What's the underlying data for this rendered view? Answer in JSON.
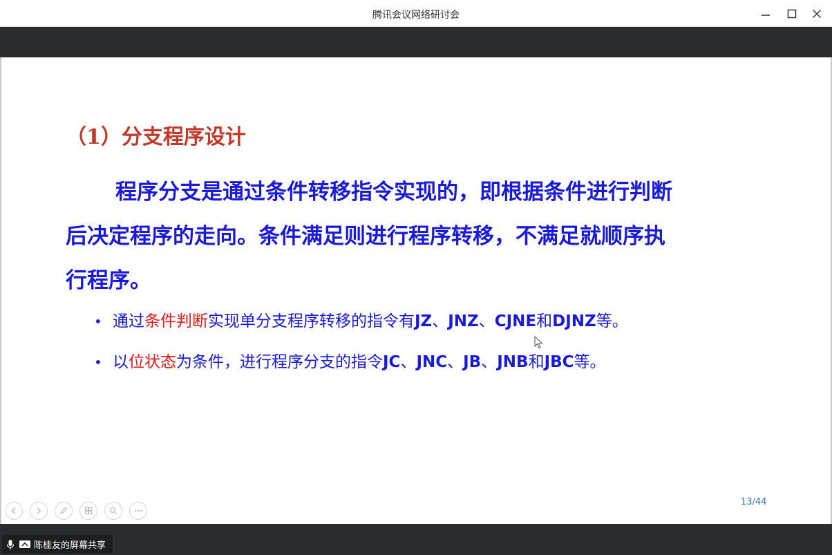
{
  "window": {
    "title": "腾讯会议网络研讨会",
    "controls": [
      "minimize-icon",
      "maximize-icon",
      "close-icon"
    ]
  },
  "slide": {
    "heading": "（1）分支程序设计",
    "paragraph_lines": [
      "程序分支是通过条件转移指令实现的，即根据条件进行判断",
      "后决定程序的走向。条件满足则进行程序转移，不满足就顺序执",
      "行程序。"
    ],
    "bullets": [
      {
        "marker": "•",
        "parts": [
          {
            "text": "通过",
            "style": "normal"
          },
          {
            "text": "条件判断",
            "style": "highlight"
          },
          {
            "text": "实现单分支程序转移的指令有",
            "style": "normal"
          },
          {
            "text": "JZ",
            "style": "code"
          },
          {
            "text": "、",
            "style": "normal"
          },
          {
            "text": "JNZ",
            "style": "code"
          },
          {
            "text": "、",
            "style": "normal"
          },
          {
            "text": "CJNE",
            "style": "code"
          },
          {
            "text": "和",
            "style": "normal"
          },
          {
            "text": "DJNZ",
            "style": "code"
          },
          {
            "text": "等。",
            "style": "normal"
          }
        ]
      },
      {
        "marker": "•",
        "parts": [
          {
            "text": "以",
            "style": "normal"
          },
          {
            "text": "位状态",
            "style": "highlight"
          },
          {
            "text": "为条件，进行程序分支的指令",
            "style": "normal"
          },
          {
            "text": "JC",
            "style": "code"
          },
          {
            "text": "、",
            "style": "normal"
          },
          {
            "text": "JNC",
            "style": "code"
          },
          {
            "text": "、",
            "style": "normal"
          },
          {
            "text": "JB",
            "style": "code"
          },
          {
            "text": "、",
            "style": "normal"
          },
          {
            "text": "JNB",
            "style": "code"
          },
          {
            "text": "和",
            "style": "normal"
          },
          {
            "text": "JBC",
            "style": "code"
          },
          {
            "text": "等。",
            "style": "normal"
          }
        ]
      }
    ],
    "page_indicator": "13/44"
  },
  "slide_toolbar": [
    "prev-icon",
    "next-icon",
    "pen-icon",
    "slides-grid-icon",
    "zoom-icon",
    "more-icon"
  ],
  "share_bar": {
    "label": "陈桂友的屏幕共享",
    "icons": [
      "microphone-icon",
      "screen-share-icon"
    ]
  },
  "colors": {
    "heading": "#c0392b",
    "body_text": "#1a1ad8",
    "highlight": "#e01b1b",
    "page_indicator": "#3a6ea8",
    "dark_bar": "#2b2c2e"
  }
}
